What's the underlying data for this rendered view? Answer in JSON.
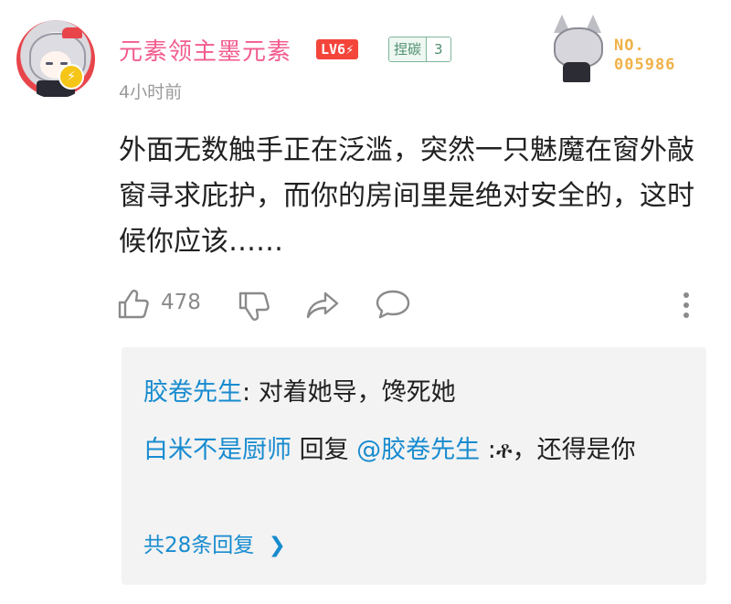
{
  "comment": {
    "username": "元素领主墨元素",
    "level": "LV6",
    "level_suffix": "⚡",
    "medal_name": "捏碳",
    "medal_level": "3",
    "time": "4小时前",
    "fan_no_label": "NO.",
    "fan_no_value": "005986",
    "text": "外面无数触手正在泛滥，突然一只魅魔在窗外敲窗寻求庇护，而你的房间里是绝对安全的，这时候你应该……",
    "like_count": "478"
  },
  "replies": {
    "items": [
      {
        "author": "胶卷先生",
        "sep": ": ",
        "text": "对着她导，馋死她"
      },
      {
        "author": "白米不是厨师",
        "mid": " 回复 ",
        "mention": "@胶卷先生",
        "text": " :ቶ，还得是你"
      }
    ],
    "more_label": "共28条回复",
    "more_chevron": "❯"
  },
  "icons": {
    "like": "thumb-up-icon",
    "dislike": "thumb-down-icon",
    "share": "share-icon",
    "reply": "comment-bubble-icon",
    "more": "more-vertical-icon",
    "badge": "lightning-badge-icon"
  },
  "colors": {
    "username": "#f25d8e",
    "link": "#178bcf",
    "level_badge": "#f4453b",
    "fan_no": "#f0b24a"
  }
}
